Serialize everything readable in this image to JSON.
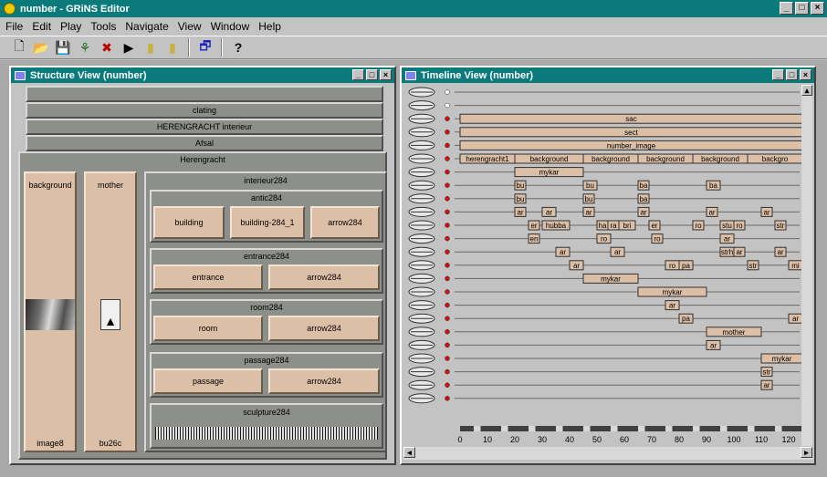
{
  "app": {
    "title": "number - GRiNS Editor"
  },
  "menu": [
    "File",
    "Edit",
    "Play",
    "Tools",
    "Navigate",
    "View",
    "Window",
    "Help"
  ],
  "structure": {
    "title": "Structure View (number)",
    "top_bars": [
      "",
      "clating",
      "HERENGRACHT interieur",
      "Afsal"
    ],
    "herengracht": "Herengracht",
    "col1": {
      "label": "background",
      "bottom": "image8"
    },
    "col2": {
      "label": "mother",
      "bottom": "bu26c"
    },
    "interieur": "interieur284",
    "antic": "antic284",
    "antic_items": [
      "building",
      "building-284_1",
      "arrow284"
    ],
    "entrance": "entrance284",
    "entrance_items": [
      "entrance",
      "arrow284"
    ],
    "room": "room284",
    "room_items": [
      "room",
      "arrow284"
    ],
    "passage": "passage284",
    "passage_items": [
      "passage",
      "arrow284"
    ],
    "sculpture": "sculpture284"
  },
  "timeline": {
    "title": "Timeline View (number)",
    "ticks": [
      "0",
      "10",
      "20",
      "30",
      "40",
      "50",
      "60",
      "70",
      "80",
      "90",
      "100",
      "110",
      "120"
    ],
    "bars": [
      {
        "row": 2,
        "start": 0,
        "end": 125,
        "label": "sac"
      },
      {
        "row": 3,
        "start": 0,
        "end": 125,
        "label": "sect"
      },
      {
        "row": 4,
        "start": 0,
        "end": 125,
        "label": "number_image"
      },
      {
        "row": 5,
        "start": 0,
        "end": 20,
        "label": "herengracht1"
      },
      {
        "row": 5,
        "start": 20,
        "end": 45,
        "label": "background"
      },
      {
        "row": 5,
        "start": 45,
        "end": 65,
        "label": "background"
      },
      {
        "row": 5,
        "start": 65,
        "end": 85,
        "label": "background"
      },
      {
        "row": 5,
        "start": 85,
        "end": 105,
        "label": "background"
      },
      {
        "row": 5,
        "start": 105,
        "end": 125,
        "label": "backgro"
      },
      {
        "row": 6,
        "start": 20,
        "end": 45,
        "label": "mykar"
      },
      {
        "row": 7,
        "start": 20,
        "end": 24,
        "label": "bu"
      },
      {
        "row": 7,
        "start": 45,
        "end": 50,
        "label": "bu"
      },
      {
        "row": 7,
        "start": 65,
        "end": 69,
        "label": "ba"
      },
      {
        "row": 7,
        "start": 90,
        "end": 95,
        "label": "ba"
      },
      {
        "row": 8,
        "start": 20,
        "end": 24,
        "label": "bu"
      },
      {
        "row": 8,
        "start": 45,
        "end": 49,
        "label": "bu"
      },
      {
        "row": 8,
        "start": 65,
        "end": 69,
        "label": "ba"
      },
      {
        "row": 9,
        "start": 20,
        "end": 24,
        "label": "ar"
      },
      {
        "row": 9,
        "start": 30,
        "end": 35,
        "label": "ar"
      },
      {
        "row": 9,
        "start": 45,
        "end": 49,
        "label": "ar"
      },
      {
        "row": 9,
        "start": 65,
        "end": 69,
        "label": "ar"
      },
      {
        "row": 9,
        "start": 90,
        "end": 94,
        "label": "ar"
      },
      {
        "row": 9,
        "start": 110,
        "end": 114,
        "label": "ar"
      },
      {
        "row": 10,
        "start": 25,
        "end": 29,
        "label": "er"
      },
      {
        "row": 10,
        "start": 30,
        "end": 40,
        "label": "hubba"
      },
      {
        "row": 10,
        "start": 50,
        "end": 54,
        "label": "ha"
      },
      {
        "row": 10,
        "start": 54,
        "end": 58,
        "label": "ra"
      },
      {
        "row": 10,
        "start": 58,
        "end": 64,
        "label": "bri"
      },
      {
        "row": 10,
        "start": 69,
        "end": 73,
        "label": "er"
      },
      {
        "row": 10,
        "start": 85,
        "end": 89,
        "label": "ro"
      },
      {
        "row": 10,
        "start": 95,
        "end": 100,
        "label": "stu"
      },
      {
        "row": 10,
        "start": 100,
        "end": 104,
        "label": "ro"
      },
      {
        "row": 10,
        "start": 115,
        "end": 119,
        "label": "str"
      },
      {
        "row": 11,
        "start": 25,
        "end": 29,
        "label": "en"
      },
      {
        "row": 11,
        "start": 50,
        "end": 55,
        "label": "ro"
      },
      {
        "row": 11,
        "start": 70,
        "end": 74,
        "label": "ro"
      },
      {
        "row": 11,
        "start": 95,
        "end": 100,
        "label": "ar"
      },
      {
        "row": 12,
        "start": 35,
        "end": 40,
        "label": "ar"
      },
      {
        "row": 12,
        "start": 55,
        "end": 60,
        "label": "ar"
      },
      {
        "row": 12,
        "start": 95,
        "end": 100,
        "label": "strh"
      },
      {
        "row": 12,
        "start": 100,
        "end": 104,
        "label": "ar"
      },
      {
        "row": 12,
        "start": 115,
        "end": 119,
        "label": "ar"
      },
      {
        "row": 13,
        "start": 40,
        "end": 45,
        "label": "ar"
      },
      {
        "row": 13,
        "start": 75,
        "end": 80,
        "label": "ro"
      },
      {
        "row": 13,
        "start": 80,
        "end": 85,
        "label": "pa"
      },
      {
        "row": 13,
        "start": 105,
        "end": 109,
        "label": "str"
      },
      {
        "row": 13,
        "start": 120,
        "end": 125,
        "label": "mi"
      },
      {
        "row": 14,
        "start": 45,
        "end": 65,
        "label": "mykar"
      },
      {
        "row": 15,
        "start": 65,
        "end": 90,
        "label": "mykar"
      },
      {
        "row": 16,
        "start": 75,
        "end": 80,
        "label": "ar"
      },
      {
        "row": 17,
        "start": 80,
        "end": 85,
        "label": "pa"
      },
      {
        "row": 17,
        "start": 120,
        "end": 125,
        "label": "ar"
      },
      {
        "row": 18,
        "start": 90,
        "end": 110,
        "label": "mother"
      },
      {
        "row": 19,
        "start": 90,
        "end": 95,
        "label": "ar"
      },
      {
        "row": 20,
        "start": 110,
        "end": 125,
        "label": "mykar"
      },
      {
        "row": 21,
        "start": 110,
        "end": 114,
        "label": "str"
      },
      {
        "row": 22,
        "start": 110,
        "end": 114,
        "label": "ar"
      }
    ]
  }
}
